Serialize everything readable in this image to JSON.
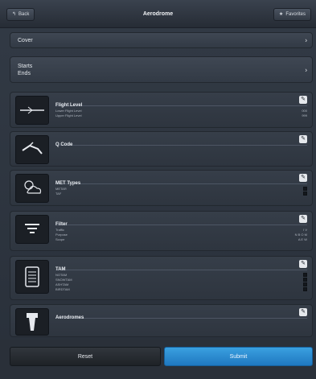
{
  "header": {
    "back_label": "Back",
    "title": "Aerodrome",
    "favorites_label": "Favorites"
  },
  "cover": {
    "label": "Cover"
  },
  "time": {
    "starts_label": "Starts",
    "ends_label": "Ends",
    "starts_value": "",
    "ends_value": ""
  },
  "sections": {
    "flight_level": {
      "title": "Flight Level",
      "items": [
        {
          "label": "Lower Flight Level",
          "value": "000"
        },
        {
          "label": "Upper Flight Level",
          "value": "999"
        }
      ]
    },
    "q_code": {
      "title": "Q Code"
    },
    "met_types": {
      "title": "MET Types",
      "items": [
        {
          "label": "METAR"
        },
        {
          "label": "TAF"
        }
      ]
    },
    "filter": {
      "title": "Filter",
      "items": [
        {
          "label": "Traffic",
          "value": "I V"
        },
        {
          "label": "Purpose",
          "value": "N B O M"
        },
        {
          "label": "Scope",
          "value": "A E W"
        }
      ]
    },
    "tam": {
      "title": "TAM",
      "items": [
        {
          "label": "NOTAM"
        },
        {
          "label": "SNOWTAM"
        },
        {
          "label": "ASHTAM"
        },
        {
          "label": "BIRDTAM"
        }
      ]
    },
    "aerodromes": {
      "title": "Aerodromes"
    }
  },
  "buttons": {
    "reset": "Reset",
    "submit": "Submit"
  },
  "colors": {
    "accent": "#2a8ad2",
    "background": "#2b323c"
  }
}
